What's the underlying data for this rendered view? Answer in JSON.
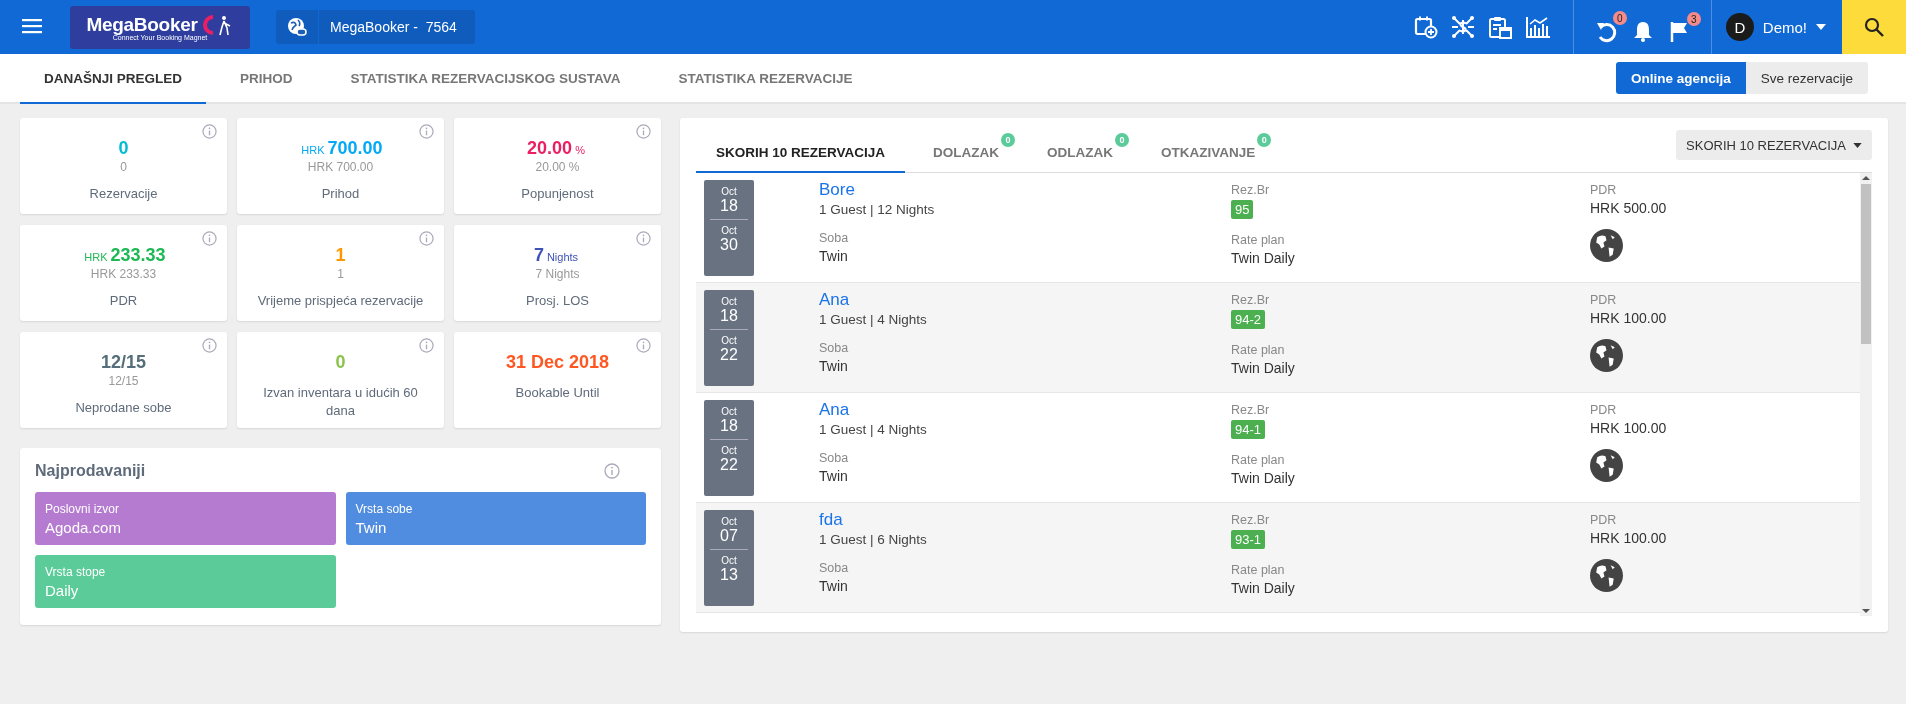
{
  "topbar": {
    "logo": {
      "name": "MegaBooker",
      "tagline": "Connect Your Booking Magnet"
    },
    "property": "MegaBooker -  7564",
    "counters": [
      {
        "kind": "undo",
        "badge": "0"
      },
      {
        "kind": "bell"
      },
      {
        "kind": "flag",
        "badge": "3"
      }
    ],
    "user": {
      "initial": "D",
      "name": "Demo!"
    }
  },
  "tabs": [
    {
      "label": "DANAŠNJI PREGLED",
      "selected": true
    },
    {
      "label": "PRIHOD",
      "selected": false
    },
    {
      "label": "STATISTIKA REZERVACIJSKOG SUSTAVA",
      "selected": false
    },
    {
      "label": "STATISTIKA REZERVACIJE",
      "selected": false
    }
  ],
  "view_buttons": [
    {
      "label": "Online agencija",
      "selected": true
    },
    {
      "label": "Sve rezervacije",
      "selected": false
    }
  ],
  "stats": [
    {
      "value": "0",
      "subvalue": "0",
      "label": "Rezervacije",
      "color": "#00bcd4"
    },
    {
      "prefix": "HRK",
      "value": "700.00",
      "subvalue": "HRK 700.00",
      "label": "Prihod",
      "color": "#03a9f4"
    },
    {
      "value": "20.00",
      "suffix": "%",
      "subvalue": "20.00 %",
      "label": "Popunjenost",
      "color": "#e91e63"
    },
    {
      "prefix": "HRK",
      "value": "233.33",
      "subvalue": "HRK 233.33",
      "label": "PDR",
      "color": "#1db954"
    },
    {
      "value": "1",
      "subvalue": "1",
      "label": "Vrijeme prispjeća rezervacije",
      "color": "#ff9800"
    },
    {
      "value": "7",
      "suffix": "Nights",
      "subvalue": "7 Nights",
      "label": "Prosj. LOS",
      "color": "#3f51b5"
    },
    {
      "value": "12/15",
      "subvalue": "12/15",
      "label": "Neprodane sobe",
      "color": "#546e7a"
    },
    {
      "value": "0",
      "label": "Izvan inventara u idućih 60 dana",
      "color": "#8bc34a"
    },
    {
      "value": "31 Dec 2018",
      "label": "Bookable Until",
      "color": "#ff5722"
    }
  ],
  "bestsellers": {
    "title": "Najprodavaniji",
    "items": [
      {
        "label": "Poslovni izvor",
        "value": "Agoda.com",
        "color": "#b57bd0"
      },
      {
        "label": "Vrsta sobe",
        "value": "Twin",
        "color": "#508de0"
      },
      {
        "label": "Vrsta stope",
        "value": "Daily",
        "color": "#5acb99"
      }
    ]
  },
  "reservations": {
    "tabs": [
      {
        "label": "SKORIH 10 REZERVACIJA",
        "selected": true
      },
      {
        "label": "DOLAZAK",
        "badge": "0",
        "selected": false
      },
      {
        "label": "ODLAZAK",
        "badge": "0",
        "selected": false
      },
      {
        "label": "OTKAZIVANJE",
        "badge": "0",
        "selected": false
      }
    ],
    "filter": "SKORIH 10 REZERVACIJA",
    "rows": [
      {
        "from": {
          "month": "Oct",
          "day": "18"
        },
        "to": {
          "month": "Oct",
          "day": "30"
        },
        "guest": "Bore",
        "details": "1 Guest | 12 Nights",
        "room_label": "Soba",
        "room": "Twin",
        "rez_label": "Rez.Br",
        "rez_no": "95",
        "rate_label": "Rate plan",
        "rate_plan": "Twin Daily",
        "pdr_label": "PDR",
        "pdr": "HRK 500.00"
      },
      {
        "from": {
          "month": "Oct",
          "day": "18"
        },
        "to": {
          "month": "Oct",
          "day": "22"
        },
        "guest": "Ana",
        "details": "1 Guest | 4 Nights",
        "room_label": "Soba",
        "room": "Twin",
        "rez_label": "Rez.Br",
        "rez_no": "94-2",
        "rate_label": "Rate plan",
        "rate_plan": "Twin Daily",
        "pdr_label": "PDR",
        "pdr": "HRK 100.00"
      },
      {
        "from": {
          "month": "Oct",
          "day": "18"
        },
        "to": {
          "month": "Oct",
          "day": "22"
        },
        "guest": "Ana",
        "details": "1 Guest | 4 Nights",
        "room_label": "Soba",
        "room": "Twin",
        "rez_label": "Rez.Br",
        "rez_no": "94-1",
        "rate_label": "Rate plan",
        "rate_plan": "Twin Daily",
        "pdr_label": "PDR",
        "pdr": "HRK 100.00"
      },
      {
        "from": {
          "month": "Oct",
          "day": "07"
        },
        "to": {
          "month": "Oct",
          "day": "13"
        },
        "guest": "fda",
        "details": "1 Guest | 6 Nights",
        "room_label": "Soba",
        "room": "Twin",
        "rez_label": "Rez.Br",
        "rez_no": "93-1",
        "rate_label": "Rate plan",
        "rate_plan": "Twin Daily",
        "pdr_label": "PDR",
        "pdr": "HRK 100.00"
      }
    ]
  }
}
